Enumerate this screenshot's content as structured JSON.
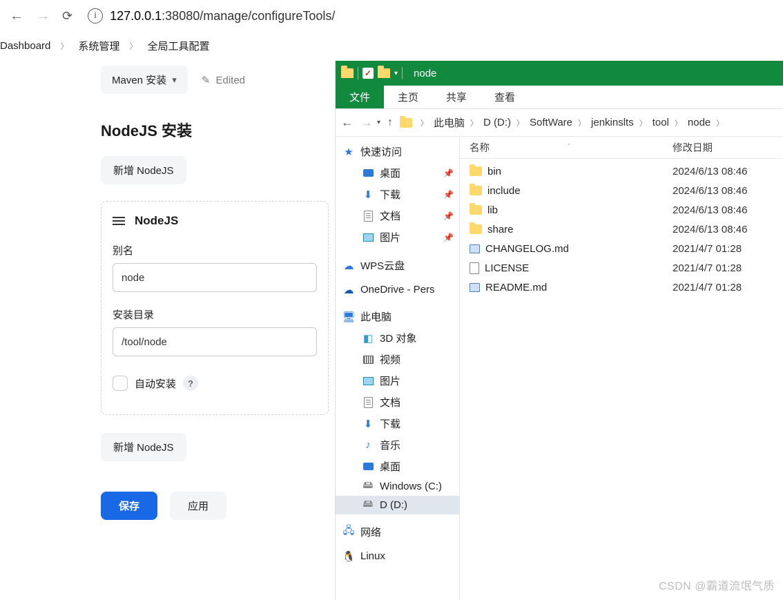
{
  "browser": {
    "url_host": "127.0.0.1",
    "url_port_path": ":38080/manage/configureTools/"
  },
  "breadcrumb": {
    "items": [
      "Dashboard",
      "系统管理",
      "全局工具配置"
    ]
  },
  "jenkins": {
    "maven_pill": "Maven 安装",
    "edited_label": "Edited",
    "nodejs_section_title": "NodeJS 安装",
    "add_nodejs_label": "新增 NodeJS",
    "panel_title": "NodeJS",
    "alias_label": "别名",
    "alias_value": "node",
    "install_dir_label": "安装目录",
    "install_dir_value": "/tool/node",
    "auto_install_label": "自动安装",
    "help_mark": "?",
    "save_label": "保存",
    "apply_label": "应用"
  },
  "explorer": {
    "window_title": "node",
    "tabs": [
      "文件",
      "主页",
      "共享",
      "查看"
    ],
    "path": [
      "此电脑",
      "D (D:)",
      "SoftWare",
      "jenkinslts",
      "tool",
      "node"
    ],
    "columns": {
      "name": "名称",
      "date": "修改日期"
    },
    "sidebar": {
      "quick_access": "快速访问",
      "desktop": "桌面",
      "downloads": "下载",
      "documents": "文档",
      "pictures": "图片",
      "wps": "WPS云盘",
      "onedrive": "OneDrive - Pers",
      "this_pc": "此电脑",
      "objects_3d": "3D 对象",
      "videos": "视频",
      "pictures2": "图片",
      "documents2": "文档",
      "downloads2": "下载",
      "music": "音乐",
      "desktop2": "桌面",
      "windows_c": "Windows (C:)",
      "d_drive": "D (D:)",
      "network": "网络",
      "linux": "Linux"
    },
    "files": [
      {
        "name": "bin",
        "date": "2024/6/13 08:46",
        "type": "folder"
      },
      {
        "name": "include",
        "date": "2024/6/13 08:46",
        "type": "folder"
      },
      {
        "name": "lib",
        "date": "2024/6/13 08:46",
        "type": "folder"
      },
      {
        "name": "share",
        "date": "2024/6/13 08:46",
        "type": "folder"
      },
      {
        "name": "CHANGELOG.md",
        "date": "2021/4/7 01:28",
        "type": "md"
      },
      {
        "name": "LICENSE",
        "date": "2021/4/7 01:28",
        "type": "file"
      },
      {
        "name": "README.md",
        "date": "2021/4/7 01:28",
        "type": "md"
      }
    ]
  },
  "watermark": "CSDN @霸道流氓气质"
}
